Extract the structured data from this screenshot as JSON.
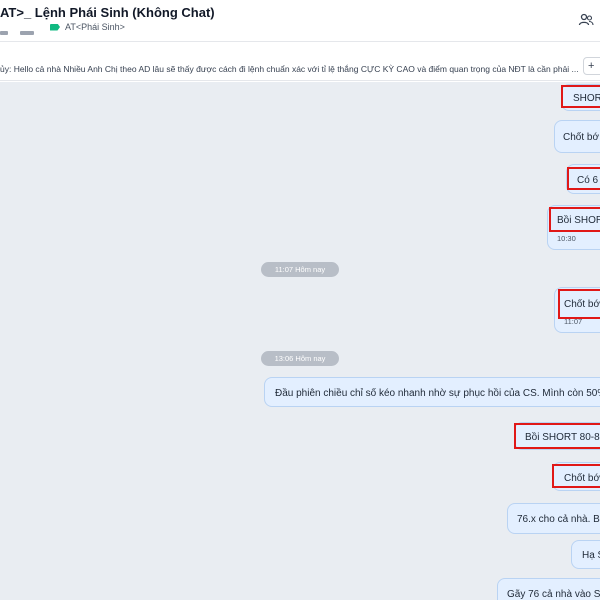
{
  "header": {
    "title": "AT>_ Lệnh Phái Sinh (Không Chat)",
    "tag_label": "AT<Phái Sinh>"
  },
  "pinned": {
    "text": "ủy: Hello cả nhà Nhiều Anh Chị theo AD lâu sẽ thấy được cách đi lệnh chuẩn xác với tỉ lệ thắng CỰC KỲ CAO và điểm quan trọng của NĐT là cần phải ...",
    "button_label": "+"
  },
  "separators": [
    {
      "label": "11:07 Hôm nay"
    },
    {
      "label": "13:06 Hôm nay"
    }
  ],
  "messages": [
    {
      "text": "SHOR",
      "time": ""
    },
    {
      "text": "Chốt bớ",
      "time": ""
    },
    {
      "text": "Có 6",
      "time": ""
    },
    {
      "text": "Bồi SHORT",
      "time": "10:30"
    },
    {
      "text": "Chốt bớ",
      "time": "11:07"
    },
    {
      "text": "Đầu phiên chiều chỉ số kéo nhanh nhờ sự phục hồi của CS. Mình còn 50% c",
      "time": ""
    },
    {
      "text": "Bồi SHORT 80-82",
      "time": ""
    },
    {
      "text": "Chốt bớ",
      "time": ""
    },
    {
      "text": "76.x cho cả nhà. Bất",
      "time": ""
    },
    {
      "text": "Hạ S",
      "time": ""
    },
    {
      "text": "Gãy 76 cả nhà vào SH",
      "time": ""
    }
  ],
  "icons": {
    "members": "members-icon",
    "tag": "tag-icon"
  },
  "colors": {
    "bubble_bg": "#e3efff",
    "bubble_border": "#b9d3f3",
    "highlight": "#e01818",
    "chat_bg": "#e9edf2",
    "tag_green": "#10b981"
  }
}
